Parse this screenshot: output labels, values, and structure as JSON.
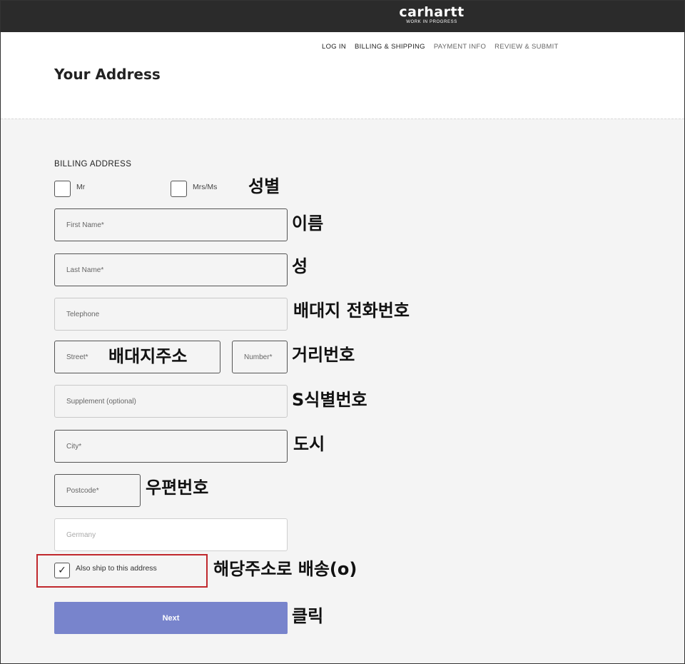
{
  "brand": {
    "wordmark": "carhartt",
    "tagline": "WORK IN PROGRESS"
  },
  "steps": [
    {
      "label": "LOG IN",
      "active": true
    },
    {
      "label": "BILLING & SHIPPING",
      "active": true
    },
    {
      "label": "PAYMENT INFO",
      "active": false
    },
    {
      "label": "REVIEW & SUBMIT",
      "active": false
    }
  ],
  "page_title": "Your Address",
  "billing": {
    "section_label": "BILLING ADDRESS",
    "salutation_mr": "Mr",
    "salutation_mrs": "Mrs/Ms",
    "first_name_placeholder": "First Name*",
    "last_name_placeholder": "Last Name*",
    "telephone_placeholder": "Telephone",
    "street_placeholder": "Street*",
    "number_placeholder": "Number*",
    "supplement_placeholder": "Supplement (optional)",
    "city_placeholder": "City*",
    "postcode_placeholder": "Postcode*",
    "country_value": "Germany",
    "ship_checkbox_label": "Also ship to this address",
    "ship_checkbox_checked": true,
    "next_label": "Next"
  },
  "annotations": {
    "gender": "성별",
    "first_name": "이름",
    "last_name": "성",
    "telephone": "배대지 전화번호",
    "street": "배대지주소",
    "number": "거리번호",
    "supplement": "S식별번호",
    "city": "도시",
    "postcode": "우편번호",
    "ship": "해당주소로 배송(o)",
    "click": "클릭"
  },
  "colors": {
    "header_bg": "#2b2b2b",
    "form_bg": "#f4f4f4",
    "next_button": "#7884cc",
    "highlight_border": "#c0282d"
  }
}
